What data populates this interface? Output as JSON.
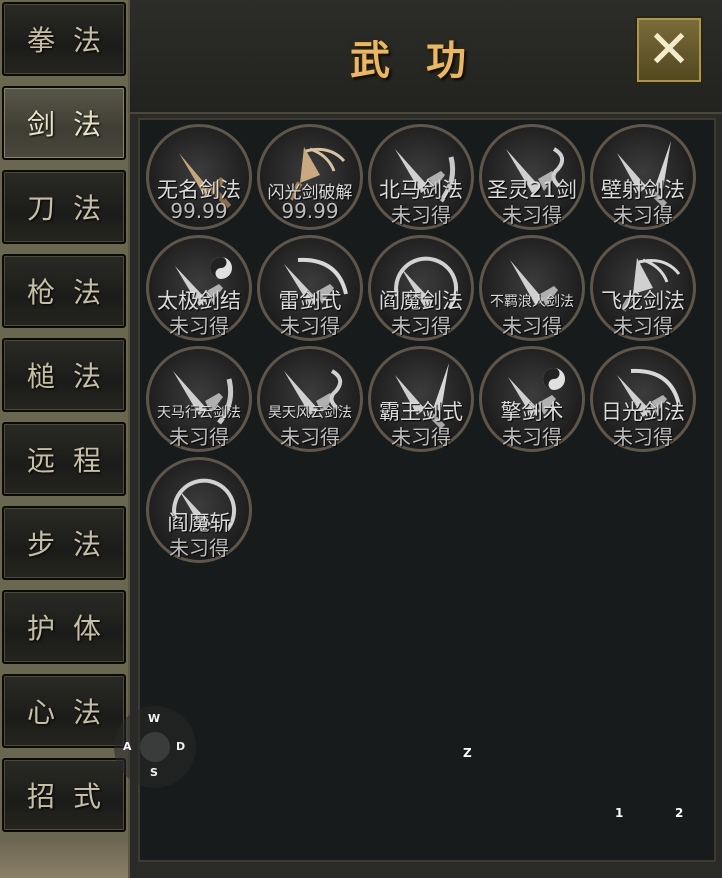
{
  "title": "武功",
  "close_icon": "close-x-icon",
  "tabs": [
    {
      "label": "拳法",
      "active": false
    },
    {
      "label": "剑法",
      "active": true
    },
    {
      "label": "刀法",
      "active": false
    },
    {
      "label": "枪法",
      "active": false
    },
    {
      "label": "槌法",
      "active": false
    },
    {
      "label": "远程",
      "active": false
    },
    {
      "label": "步法",
      "active": false
    },
    {
      "label": "护体",
      "active": false
    },
    {
      "label": "心法",
      "active": false
    },
    {
      "label": "招式",
      "active": false
    }
  ],
  "skills": [
    {
      "name": "无名剑法",
      "level": "99.99",
      "icon": "sword-tan-icon"
    },
    {
      "name": "闪光剑破解",
      "level": "99.99",
      "icon": "flash-sword-icon"
    },
    {
      "name": "北马剑法",
      "level": "未习得",
      "icon": "sword-slash-icon"
    },
    {
      "name": "圣灵21剑",
      "level": "未习得",
      "icon": "sword-spirit-icon"
    },
    {
      "name": "壁射剑法",
      "level": "未习得",
      "icon": "twin-sword-icon"
    },
    {
      "name": "太极剑结",
      "level": "未习得",
      "icon": "taiji-sword-icon"
    },
    {
      "name": "雷剑式",
      "level": "未习得",
      "icon": "sword-arc-icon"
    },
    {
      "name": "阎魔剑法",
      "level": "未习得",
      "icon": "sword-circle-icon"
    },
    {
      "name": "不羁浪人剑法",
      "level": "未习得",
      "icon": "sword-plain-icon"
    },
    {
      "name": "飞龙剑法",
      "level": "未习得",
      "icon": "flash-sword-icon"
    },
    {
      "name": "天马行云剑法",
      "level": "未习得",
      "icon": "sword-slash-icon"
    },
    {
      "name": "昊天风云剑法",
      "level": "未习得",
      "icon": "sword-spirit-icon"
    },
    {
      "name": "霸王剑式",
      "level": "未习得",
      "icon": "twin-sword-icon"
    },
    {
      "name": "擎剑术",
      "level": "未习得",
      "icon": "taiji-sword-icon"
    },
    {
      "name": "日光剑法",
      "level": "未习得",
      "icon": "sword-arc-icon"
    },
    {
      "name": "阎魔斩",
      "level": "未习得",
      "icon": "sword-circle-icon"
    }
  ],
  "joystick": {
    "up": "W",
    "left": "A",
    "right": "D",
    "down": "S"
  },
  "hotkeys": {
    "z": "Z",
    "one": "1",
    "two": "2"
  }
}
